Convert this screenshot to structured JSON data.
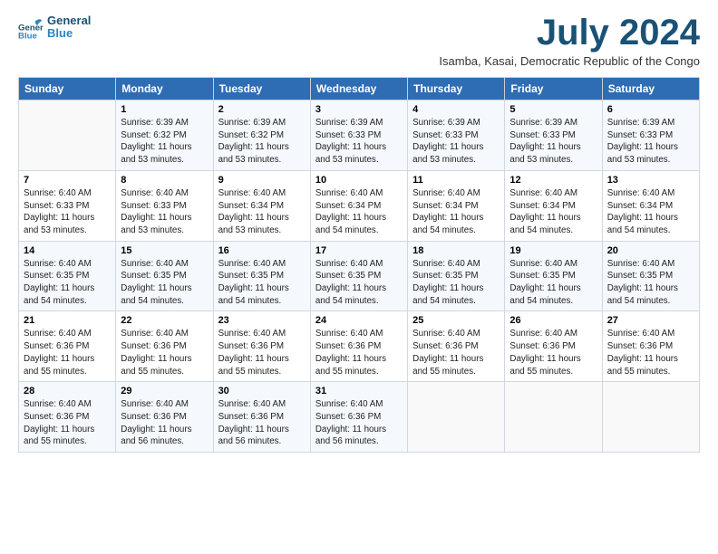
{
  "logo": {
    "line1": "General",
    "line2": "Blue"
  },
  "title": "July 2024",
  "subtitle": "Isamba, Kasai, Democratic Republic of the Congo",
  "weekdays": [
    "Sunday",
    "Monday",
    "Tuesday",
    "Wednesday",
    "Thursday",
    "Friday",
    "Saturday"
  ],
  "weeks": [
    [
      {
        "day": "",
        "info": ""
      },
      {
        "day": "1",
        "info": "Sunrise: 6:39 AM\nSunset: 6:32 PM\nDaylight: 11 hours\nand 53 minutes."
      },
      {
        "day": "2",
        "info": "Sunrise: 6:39 AM\nSunset: 6:32 PM\nDaylight: 11 hours\nand 53 minutes."
      },
      {
        "day": "3",
        "info": "Sunrise: 6:39 AM\nSunset: 6:33 PM\nDaylight: 11 hours\nand 53 minutes."
      },
      {
        "day": "4",
        "info": "Sunrise: 6:39 AM\nSunset: 6:33 PM\nDaylight: 11 hours\nand 53 minutes."
      },
      {
        "day": "5",
        "info": "Sunrise: 6:39 AM\nSunset: 6:33 PM\nDaylight: 11 hours\nand 53 minutes."
      },
      {
        "day": "6",
        "info": "Sunrise: 6:39 AM\nSunset: 6:33 PM\nDaylight: 11 hours\nand 53 minutes."
      }
    ],
    [
      {
        "day": "7",
        "info": "Sunrise: 6:40 AM\nSunset: 6:33 PM\nDaylight: 11 hours\nand 53 minutes."
      },
      {
        "day": "8",
        "info": "Sunrise: 6:40 AM\nSunset: 6:33 PM\nDaylight: 11 hours\nand 53 minutes."
      },
      {
        "day": "9",
        "info": "Sunrise: 6:40 AM\nSunset: 6:34 PM\nDaylight: 11 hours\nand 53 minutes."
      },
      {
        "day": "10",
        "info": "Sunrise: 6:40 AM\nSunset: 6:34 PM\nDaylight: 11 hours\nand 54 minutes."
      },
      {
        "day": "11",
        "info": "Sunrise: 6:40 AM\nSunset: 6:34 PM\nDaylight: 11 hours\nand 54 minutes."
      },
      {
        "day": "12",
        "info": "Sunrise: 6:40 AM\nSunset: 6:34 PM\nDaylight: 11 hours\nand 54 minutes."
      },
      {
        "day": "13",
        "info": "Sunrise: 6:40 AM\nSunset: 6:34 PM\nDaylight: 11 hours\nand 54 minutes."
      }
    ],
    [
      {
        "day": "14",
        "info": "Sunrise: 6:40 AM\nSunset: 6:35 PM\nDaylight: 11 hours\nand 54 minutes."
      },
      {
        "day": "15",
        "info": "Sunrise: 6:40 AM\nSunset: 6:35 PM\nDaylight: 11 hours\nand 54 minutes."
      },
      {
        "day": "16",
        "info": "Sunrise: 6:40 AM\nSunset: 6:35 PM\nDaylight: 11 hours\nand 54 minutes."
      },
      {
        "day": "17",
        "info": "Sunrise: 6:40 AM\nSunset: 6:35 PM\nDaylight: 11 hours\nand 54 minutes."
      },
      {
        "day": "18",
        "info": "Sunrise: 6:40 AM\nSunset: 6:35 PM\nDaylight: 11 hours\nand 54 minutes."
      },
      {
        "day": "19",
        "info": "Sunrise: 6:40 AM\nSunset: 6:35 PM\nDaylight: 11 hours\nand 54 minutes."
      },
      {
        "day": "20",
        "info": "Sunrise: 6:40 AM\nSunset: 6:35 PM\nDaylight: 11 hours\nand 54 minutes."
      }
    ],
    [
      {
        "day": "21",
        "info": "Sunrise: 6:40 AM\nSunset: 6:36 PM\nDaylight: 11 hours\nand 55 minutes."
      },
      {
        "day": "22",
        "info": "Sunrise: 6:40 AM\nSunset: 6:36 PM\nDaylight: 11 hours\nand 55 minutes."
      },
      {
        "day": "23",
        "info": "Sunrise: 6:40 AM\nSunset: 6:36 PM\nDaylight: 11 hours\nand 55 minutes."
      },
      {
        "day": "24",
        "info": "Sunrise: 6:40 AM\nSunset: 6:36 PM\nDaylight: 11 hours\nand 55 minutes."
      },
      {
        "day": "25",
        "info": "Sunrise: 6:40 AM\nSunset: 6:36 PM\nDaylight: 11 hours\nand 55 minutes."
      },
      {
        "day": "26",
        "info": "Sunrise: 6:40 AM\nSunset: 6:36 PM\nDaylight: 11 hours\nand 55 minutes."
      },
      {
        "day": "27",
        "info": "Sunrise: 6:40 AM\nSunset: 6:36 PM\nDaylight: 11 hours\nand 55 minutes."
      }
    ],
    [
      {
        "day": "28",
        "info": "Sunrise: 6:40 AM\nSunset: 6:36 PM\nDaylight: 11 hours\nand 55 minutes."
      },
      {
        "day": "29",
        "info": "Sunrise: 6:40 AM\nSunset: 6:36 PM\nDaylight: 11 hours\nand 56 minutes."
      },
      {
        "day": "30",
        "info": "Sunrise: 6:40 AM\nSunset: 6:36 PM\nDaylight: 11 hours\nand 56 minutes."
      },
      {
        "day": "31",
        "info": "Sunrise: 6:40 AM\nSunset: 6:36 PM\nDaylight: 11 hours\nand 56 minutes."
      },
      {
        "day": "",
        "info": ""
      },
      {
        "day": "",
        "info": ""
      },
      {
        "day": "",
        "info": ""
      }
    ]
  ]
}
